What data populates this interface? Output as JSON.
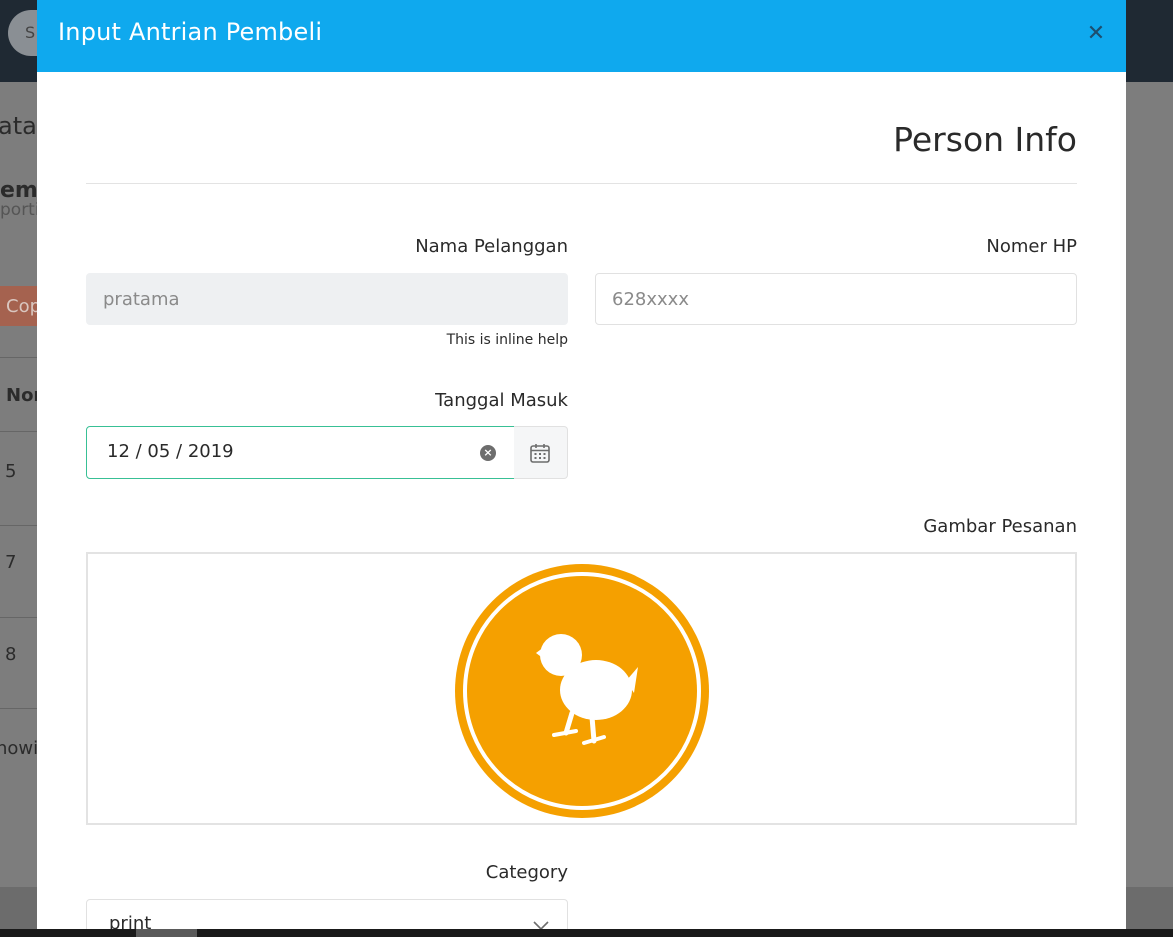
{
  "background": {
    "search_text": "S",
    "page_title_fragment": "ata A",
    "heading_fragment": "em",
    "subheading_fragment": "porti",
    "copy_button_fragment": "Cop",
    "column_header_fragment": "Nor",
    "rows": [
      "5",
      "7",
      "8"
    ],
    "footer_fragment": "nowi"
  },
  "modal": {
    "title": "Input Antrian Pembeli",
    "close_icon": "times-icon",
    "section_title": "Person Info",
    "fields": {
      "nama_pelanggan": {
        "label": "Nama Pelanggan",
        "placeholder": "pratama",
        "help": "This is inline help"
      },
      "nomer_hp": {
        "label": "Nomer HP",
        "placeholder": "628xxxx"
      },
      "tanggal_masuk": {
        "label": "Tanggal Masuk",
        "value": "12 / 05 / 2019",
        "clear_icon": "clear-icon",
        "calendar_icon": "calendar-icon"
      },
      "gambar_pesanan": {
        "label": "Gambar Pesanan",
        "image_icon": "chick-logo-icon"
      },
      "category": {
        "label": "Category",
        "selected": "print",
        "chevron_icon": "chevron-down-icon"
      }
    }
  },
  "colors": {
    "header": "#0fa9ee",
    "logo_orange": "#f5a000",
    "date_focus_border": "#38c095"
  }
}
